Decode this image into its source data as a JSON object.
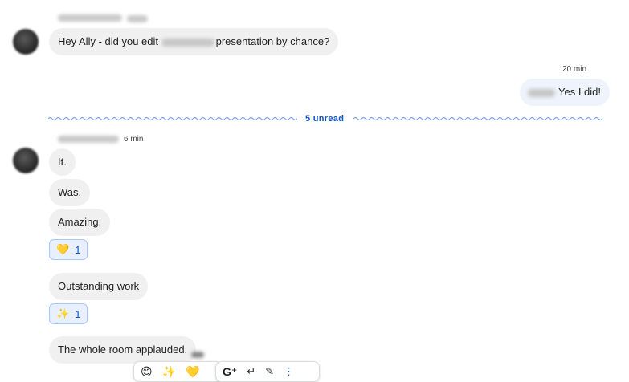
{
  "first_thread": {
    "message": {
      "text_before": "Hey Ally - did you edit ",
      "text_after": "presentation by chance?"
    }
  },
  "reply": {
    "time": "20 min",
    "text": "Yes I did!"
  },
  "unread_divider": {
    "label": "5 unread",
    "color": "#0b57d0"
  },
  "second_thread": {
    "time": "6 min",
    "messages": [
      {
        "text": "It."
      },
      {
        "text": "Was."
      },
      {
        "text": "Amazing."
      },
      {
        "reaction": {
          "icon": "yellow-heart",
          "emoji": "💛",
          "count": "1"
        }
      },
      {
        "text": "Outstanding work"
      },
      {
        "reaction": {
          "icon": "sparkles",
          "emoji": "✨",
          "count": "1"
        }
      },
      {
        "text": "The whole room applauded."
      }
    ]
  },
  "hover_toolbar": {
    "emoji_quick": [
      "😊",
      "✨",
      "💛"
    ],
    "actions": [
      "add-reaction-icon",
      "reply-icon",
      "more-vert-icon"
    ]
  }
}
